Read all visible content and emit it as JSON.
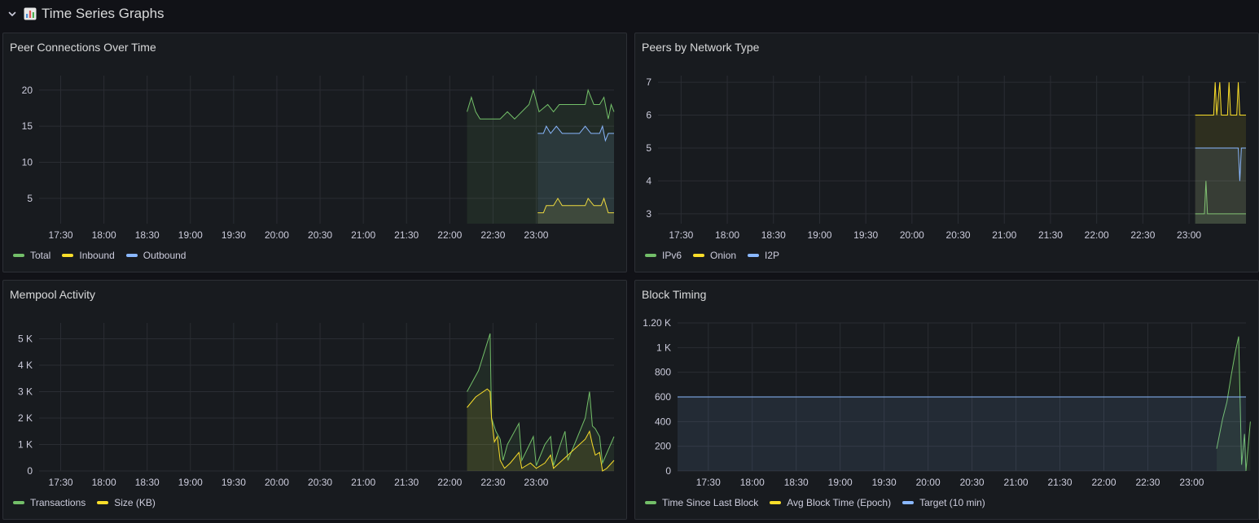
{
  "row": {
    "title": "Time Series Graphs",
    "icon": "bar-chart-icon"
  },
  "panels": [
    {
      "id": "peer-connections",
      "title": "Peer Connections Over Time",
      "legend": [
        {
          "name": "Total",
          "color": "#73bf69"
        },
        {
          "name": "Inbound",
          "color": "#fade2a"
        },
        {
          "name": "Outbound",
          "color": "#8ab8ff"
        }
      ]
    },
    {
      "id": "peers-network",
      "title": "Peers by Network Type",
      "legend": [
        {
          "name": "IPv6",
          "color": "#73bf69"
        },
        {
          "name": "Onion",
          "color": "#fade2a"
        },
        {
          "name": "I2P",
          "color": "#8ab8ff"
        }
      ]
    },
    {
      "id": "mempool",
      "title": "Mempool Activity",
      "legend": [
        {
          "name": "Transactions",
          "color": "#73bf69"
        },
        {
          "name": "Size (KB)",
          "color": "#fade2a"
        }
      ]
    },
    {
      "id": "block-timing",
      "title": "Block Timing",
      "legend": [
        {
          "name": "Time Since Last Block",
          "color": "#73bf69"
        },
        {
          "name": "Avg Block Time (Epoch)",
          "color": "#fade2a"
        },
        {
          "name": "Target (10 min)",
          "color": "#8ab8ff"
        }
      ]
    }
  ],
  "chart_data": [
    {
      "type": "line",
      "title": "Peer Connections Over Time",
      "x_ticks": [
        "17:30",
        "18:00",
        "18:30",
        "19:00",
        "19:30",
        "20:00",
        "20:30",
        "21:00",
        "21:30",
        "22:00",
        "22:30",
        "23:00"
      ],
      "y_ticks": [
        "5",
        "10",
        "15",
        "20"
      ],
      "ylim": [
        1.5,
        22
      ],
      "xlim_minutes": [
        1035,
        1434
      ],
      "series": [
        {
          "name": "Total",
          "color": "#73bf69",
          "points": [
            [
              1332,
              17
            ],
            [
              1335,
              19
            ],
            [
              1338,
              17
            ],
            [
              1341,
              16
            ],
            [
              1350,
              16
            ],
            [
              1355,
              16
            ],
            [
              1360,
              17
            ],
            [
              1365,
              16
            ],
            [
              1370,
              17
            ],
            [
              1375,
              18
            ],
            [
              1378,
              20
            ],
            [
              1382,
              17
            ],
            [
              1388,
              18
            ],
            [
              1392,
              17
            ],
            [
              1396,
              18
            ],
            [
              1400,
              18
            ],
            [
              1405,
              18
            ],
            [
              1410,
              18
            ],
            [
              1414,
              18
            ],
            [
              1416,
              20
            ],
            [
              1420,
              18
            ],
            [
              1424,
              18
            ],
            [
              1427,
              19
            ],
            [
              1430,
              16
            ],
            [
              1432,
              18
            ],
            [
              1434,
              17
            ]
          ]
        },
        {
          "name": "Inbound",
          "color": "#fade2a",
          "points": [
            [
              1381,
              3
            ],
            [
              1385,
              3
            ],
            [
              1387,
              4
            ],
            [
              1392,
              4
            ],
            [
              1395,
              5
            ],
            [
              1398,
              4
            ],
            [
              1405,
              4
            ],
            [
              1410,
              4
            ],
            [
              1414,
              4
            ],
            [
              1416,
              5
            ],
            [
              1420,
              4
            ],
            [
              1425,
              4
            ],
            [
              1427,
              5
            ],
            [
              1430,
              3
            ],
            [
              1434,
              3
            ]
          ]
        },
        {
          "name": "Outbound",
          "color": "#8ab8ff",
          "points": [
            [
              1381,
              14
            ],
            [
              1385,
              14
            ],
            [
              1387,
              15
            ],
            [
              1390,
              14
            ],
            [
              1394,
              15
            ],
            [
              1398,
              14
            ],
            [
              1405,
              14
            ],
            [
              1410,
              14
            ],
            [
              1414,
              15
            ],
            [
              1418,
              14
            ],
            [
              1424,
              14
            ],
            [
              1426,
              15
            ],
            [
              1428,
              13
            ],
            [
              1430,
              14
            ],
            [
              1434,
              14
            ]
          ]
        }
      ]
    },
    {
      "type": "line",
      "title": "Peers by Network Type",
      "x_ticks": [
        "17:30",
        "18:00",
        "18:30",
        "19:00",
        "19:30",
        "20:00",
        "20:30",
        "21:00",
        "21:30",
        "22:00",
        "22:30",
        "23:00"
      ],
      "y_ticks": [
        "3",
        "4",
        "5",
        "6",
        "7"
      ],
      "ylim": [
        2.7,
        7.2
      ],
      "xlim_minutes": [
        1035,
        1417
      ],
      "series": [
        {
          "name": "IPv6",
          "color": "#73bf69",
          "points": [
            [
              1384,
              3
            ],
            [
              1390,
              3
            ],
            [
              1391,
              4
            ],
            [
              1392,
              3
            ],
            [
              1400,
              3
            ],
            [
              1417,
              3
            ]
          ]
        },
        {
          "name": "Onion",
          "color": "#fade2a",
          "points": [
            [
              1384,
              6
            ],
            [
              1396,
              6
            ],
            [
              1397,
              7
            ],
            [
              1398,
              6
            ],
            [
              1400,
              7
            ],
            [
              1401,
              6
            ],
            [
              1405,
              6
            ],
            [
              1406,
              7
            ],
            [
              1407,
              6
            ],
            [
              1411,
              6
            ],
            [
              1412,
              7
            ],
            [
              1413,
              6
            ],
            [
              1417,
              6
            ]
          ]
        },
        {
          "name": "I2P",
          "color": "#8ab8ff",
          "points": [
            [
              1384,
              5
            ],
            [
              1412,
              5
            ],
            [
              1413,
              4
            ],
            [
              1414,
              5
            ],
            [
              1417,
              5
            ]
          ]
        }
      ]
    },
    {
      "type": "line",
      "title": "Mempool Activity",
      "x_ticks": [
        "17:30",
        "18:00",
        "18:30",
        "19:00",
        "19:30",
        "20:00",
        "20:30",
        "21:00",
        "21:30",
        "22:00",
        "22:30",
        "23:00"
      ],
      "y_ticks": [
        "0",
        "1 K",
        "2 K",
        "3 K",
        "4 K",
        "5 K"
      ],
      "ylim": [
        0,
        5600
      ],
      "xlim_minutes": [
        1035,
        1434
      ],
      "series": [
        {
          "name": "Transactions",
          "color": "#73bf69",
          "points": [
            [
              1332,
              3000
            ],
            [
              1340,
              3800
            ],
            [
              1348,
              5200
            ],
            [
              1349,
              2000
            ],
            [
              1352,
              1500
            ],
            [
              1355,
              1200
            ],
            [
              1357,
              400
            ],
            [
              1360,
              1000
            ],
            [
              1368,
              1800
            ],
            [
              1370,
              400
            ],
            [
              1378,
              1300
            ],
            [
              1380,
              200
            ],
            [
              1386,
              1000
            ],
            [
              1390,
              1300
            ],
            [
              1392,
              200
            ],
            [
              1398,
              1200
            ],
            [
              1400,
              1500
            ],
            [
              1402,
              400
            ],
            [
              1414,
              2000
            ],
            [
              1417,
              3000
            ],
            [
              1419,
              1700
            ],
            [
              1421,
              1600
            ],
            [
              1424,
              1300
            ],
            [
              1426,
              300
            ],
            [
              1434,
              1300
            ]
          ]
        },
        {
          "name": "Size (KB)",
          "color": "#fade2a",
          "points": [
            [
              1332,
              2400
            ],
            [
              1338,
              2800
            ],
            [
              1346,
              3100
            ],
            [
              1348,
              3000
            ],
            [
              1349,
              2000
            ],
            [
              1351,
              1100
            ],
            [
              1353,
              1300
            ],
            [
              1355,
              400
            ],
            [
              1358,
              100
            ],
            [
              1362,
              300
            ],
            [
              1368,
              700
            ],
            [
              1370,
              100
            ],
            [
              1376,
              300
            ],
            [
              1380,
              100
            ],
            [
              1386,
              300
            ],
            [
              1390,
              600
            ],
            [
              1392,
              100
            ],
            [
              1398,
              400
            ],
            [
              1402,
              600
            ],
            [
              1414,
              1200
            ],
            [
              1417,
              1500
            ],
            [
              1419,
              1000
            ],
            [
              1421,
              600
            ],
            [
              1424,
              700
            ],
            [
              1426,
              0
            ],
            [
              1429,
              100
            ],
            [
              1434,
              400
            ]
          ]
        }
      ]
    },
    {
      "type": "line",
      "title": "Block Timing",
      "x_ticks": [
        "17:30",
        "18:00",
        "18:30",
        "19:00",
        "19:30",
        "20:00",
        "20:30",
        "21:00",
        "21:30",
        "22:00",
        "22:30",
        "23:00"
      ],
      "y_ticks": [
        "0",
        "200",
        "400",
        "600",
        "800",
        "1 K",
        "1.20 K"
      ],
      "ylim": [
        0,
        1200
      ],
      "xlim_minutes": [
        1029,
        1417
      ],
      "series": [
        {
          "name": "Time Since Last Block",
          "color": "#73bf69",
          "points": [
            [
              1397,
              180
            ],
            [
              1399,
              300
            ],
            [
              1401,
              420
            ],
            [
              1404,
              560
            ],
            [
              1407,
              780
            ],
            [
              1410,
              980
            ],
            [
              1412,
              1090
            ],
            [
              1414,
              50
            ],
            [
              1416,
              300
            ],
            [
              1417,
              0
            ],
            [
              1420,
              400
            ]
          ]
        },
        {
          "name": "Avg Block Time (Epoch)",
          "color": "#fade2a",
          "points": []
        },
        {
          "name": "Target (10 min)",
          "color": "#8ab8ff",
          "points": [
            [
              1029,
              600
            ],
            [
              1417,
              600
            ]
          ]
        }
      ]
    }
  ]
}
